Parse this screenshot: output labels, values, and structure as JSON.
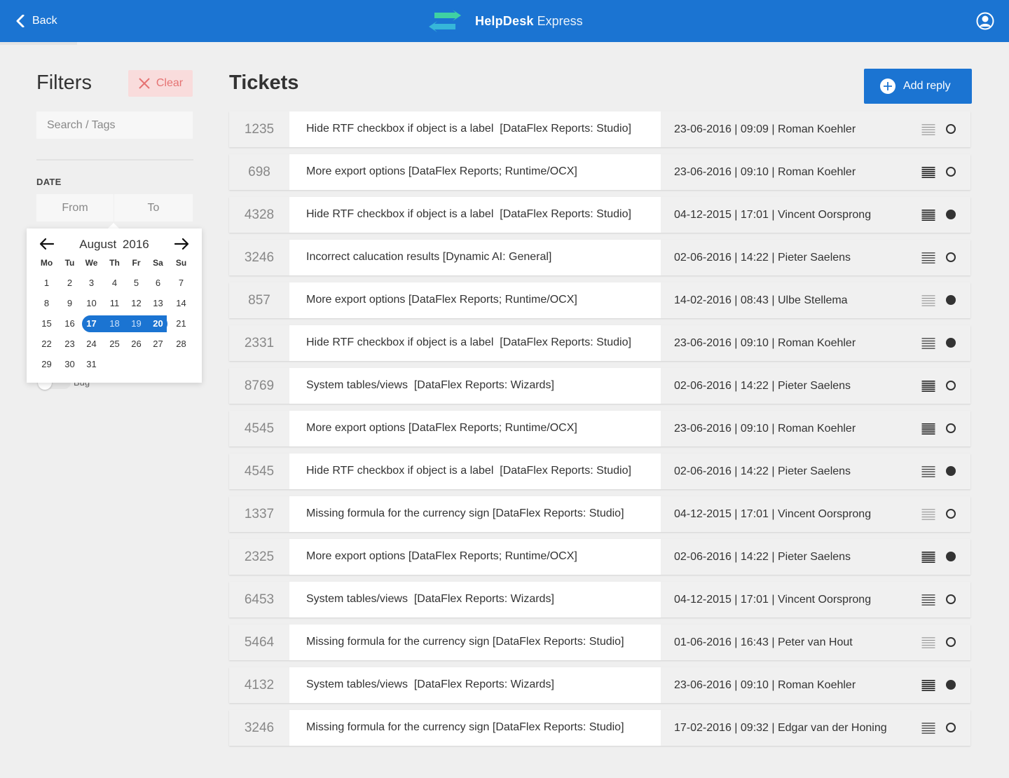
{
  "header": {
    "back_label": "Back",
    "brand_name": "HelpDesk",
    "brand_suffix": "Express",
    "brand_color": "#1b74d2"
  },
  "filters": {
    "title": "Filters",
    "clear_label": "Clear",
    "search_placeholder": "Search / Tags",
    "date_label": "DATE",
    "from_label": "From",
    "to_label": "To",
    "toggle_label": "Bug"
  },
  "calendar": {
    "month": "August",
    "year": "2016",
    "weekdays": [
      "Mo",
      "Tu",
      "We",
      "Th",
      "Fr",
      "Sa",
      "Su"
    ],
    "weeks": [
      [
        "1",
        "2",
        "3",
        "4",
        "5",
        "6",
        "7"
      ],
      [
        "8",
        "9",
        "10",
        "11",
        "12",
        "13",
        "14"
      ],
      [
        "15",
        "16",
        "17",
        "18",
        "19",
        "20",
        "21"
      ],
      [
        "22",
        "23",
        "24",
        "25",
        "26",
        "27",
        "28"
      ],
      [
        "29",
        "30",
        "31"
      ]
    ],
    "range_start": "17",
    "range_end": "20",
    "range_middle": [
      "18",
      "19"
    ]
  },
  "tickets": {
    "title": "Tickets",
    "add_reply_label": "Add reply",
    "rows": [
      {
        "id": "1235",
        "subject": "Hide RTF checkbox if object is a label  [DataFlex Reports: Studio]",
        "meta": "23-06-2016 | 09:09 | Roman Koehler",
        "priority": "light",
        "status": "open"
      },
      {
        "id": "698",
        "subject": "More export options [DataFlex Reports; Runtime/OCX]",
        "meta": "23-06-2016 | 09:10 | Roman Koehler",
        "priority": "dark",
        "status": "open"
      },
      {
        "id": "4328",
        "subject": "Hide RTF checkbox if object is a label  [DataFlex Reports: Studio]",
        "meta": "04-12-2015 | 17:01 | Vincent Oorsprong",
        "priority": "dark",
        "status": "closed"
      },
      {
        "id": "3246",
        "subject": "Incorrect calucation results [Dynamic AI: General]",
        "meta": "02-06-2016 | 14:22 | Pieter Saelens",
        "priority": "medium",
        "status": "open"
      },
      {
        "id": "857",
        "subject": "More export options [DataFlex Reports; Runtime/OCX]",
        "meta": "14-02-2016 | 08:43 | Ulbe Stellema",
        "priority": "light",
        "status": "closed"
      },
      {
        "id": "2331",
        "subject": "Hide RTF checkbox if object is a label  [DataFlex Reports: Studio]",
        "meta": "23-06-2016 | 09:10 | Roman Koehler",
        "priority": "medium",
        "status": "closed"
      },
      {
        "id": "8769",
        "subject": "System tables/views  [DataFlex Reports: Wizards]",
        "meta": "02-06-2016 | 14:22 | Pieter Saelens",
        "priority": "dark",
        "status": "open"
      },
      {
        "id": "4545",
        "subject": "More export options [DataFlex Reports; Runtime/OCX]",
        "meta": "23-06-2016 | 09:10 | Roman Koehler",
        "priority": "dark",
        "status": "open"
      },
      {
        "id": "4545",
        "subject": "Hide RTF checkbox if object is a label  [DataFlex Reports: Studio]",
        "meta": "02-06-2016 | 14:22 | Pieter Saelens",
        "priority": "medium",
        "status": "closed"
      },
      {
        "id": "1337",
        "subject": "Missing formula for the currency sign [DataFlex Reports: Studio]",
        "meta": "04-12-2015 | 17:01 | Vincent Oorsprong",
        "priority": "light",
        "status": "open"
      },
      {
        "id": "2325",
        "subject": "More export options [DataFlex Reports; Runtime/OCX]",
        "meta": "02-06-2016 | 14:22 | Pieter Saelens",
        "priority": "dark",
        "status": "closed"
      },
      {
        "id": "6453",
        "subject": "System tables/views  [DataFlex Reports: Wizards]",
        "meta": "04-12-2015 | 17:01 | Vincent Oorsprong",
        "priority": "medium",
        "status": "open"
      },
      {
        "id": "5464",
        "subject": "Missing formula for the currency sign [DataFlex Reports: Studio]",
        "meta": "01-06-2016 | 16:43 | Peter van Hout",
        "priority": "light",
        "status": "open"
      },
      {
        "id": "4132",
        "subject": "System tables/views  [DataFlex Reports: Wizards]",
        "meta": "23-06-2016 | 09:10 | Roman Koehler",
        "priority": "dark",
        "status": "closed"
      },
      {
        "id": "3246",
        "subject": "Missing formula for the currency sign [DataFlex Reports: Studio]",
        "meta": "17-02-2016 | 09:32 | Edgar van der Honing",
        "priority": "medium",
        "status": "open"
      }
    ]
  }
}
